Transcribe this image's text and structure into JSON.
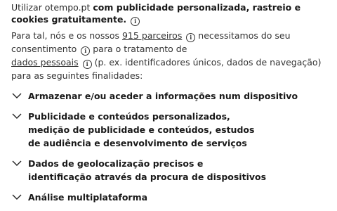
{
  "intro": {
    "site": "Utilizar otempo.pt",
    "bold_text": "com publicidade personalizada, rastreio e cookies gratuitamente."
  },
  "paragraph": {
    "part1": "Para tal, nós e os nossos ",
    "partners_link": "915 parceiros",
    "part2": " necessitamos do seu consentimento",
    "part3": " para o tratamento de ",
    "personal_data_link": "dados pessoais",
    "part4": " (p. ex. identificadores únicos, dados de navegação) para as seguintes finalidades:"
  },
  "purposes": [
    {
      "label": "Armazenar e/ou aceder a informações num dispositivo"
    },
    {
      "label": "Publicidade e conteúdos personalizados,\nmedição de publicidade e conteúdos, estudos\nde audiência e desenvolvimento de serviços"
    },
    {
      "label": "Dados de geolocalização precisos e\nidentificação através da procura de dispositivos"
    },
    {
      "label": "Análise multiplataforma"
    }
  ],
  "icons": {
    "info": "info-icon",
    "expand": "chevron-down-icon"
  }
}
